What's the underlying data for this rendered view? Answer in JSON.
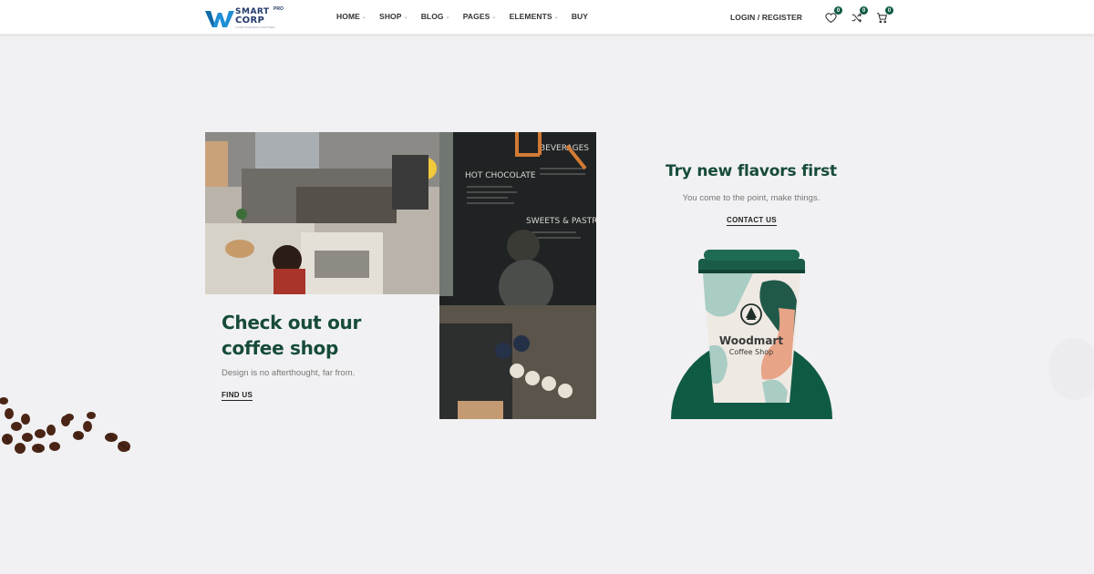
{
  "logo": {
    "top": "SMART",
    "pro": "PRO",
    "bottom": "CORP",
    "tagline": "YOUR BUSINESS PARTNER"
  },
  "nav": {
    "items": [
      {
        "label": "HOME",
        "dropdown": true
      },
      {
        "label": "SHOP",
        "dropdown": true
      },
      {
        "label": "BLOG",
        "dropdown": true
      },
      {
        "label": "PAGES",
        "dropdown": true
      },
      {
        "label": "ELEMENTS",
        "dropdown": true
      },
      {
        "label": "BUY",
        "dropdown": false
      }
    ]
  },
  "header_right": {
    "login": "LOGIN / REGISTER",
    "wishlist_count": "0",
    "compare_count": "0",
    "cart_count": "0"
  },
  "left_banner": {
    "title": "Check out our coffee shop",
    "subtitle": "Design is no afterthought, far from.",
    "link": "FIND US"
  },
  "right_banner": {
    "title": "Try new flavors first",
    "subtitle": "You come to the point, make things.",
    "link": "CONTACT US",
    "cup_brand": "Woodmart",
    "cup_sub": "Coffee Shop"
  },
  "colors": {
    "accent": "#174b3a",
    "badge": "#0f5a45",
    "background": "#f1f1f3"
  }
}
